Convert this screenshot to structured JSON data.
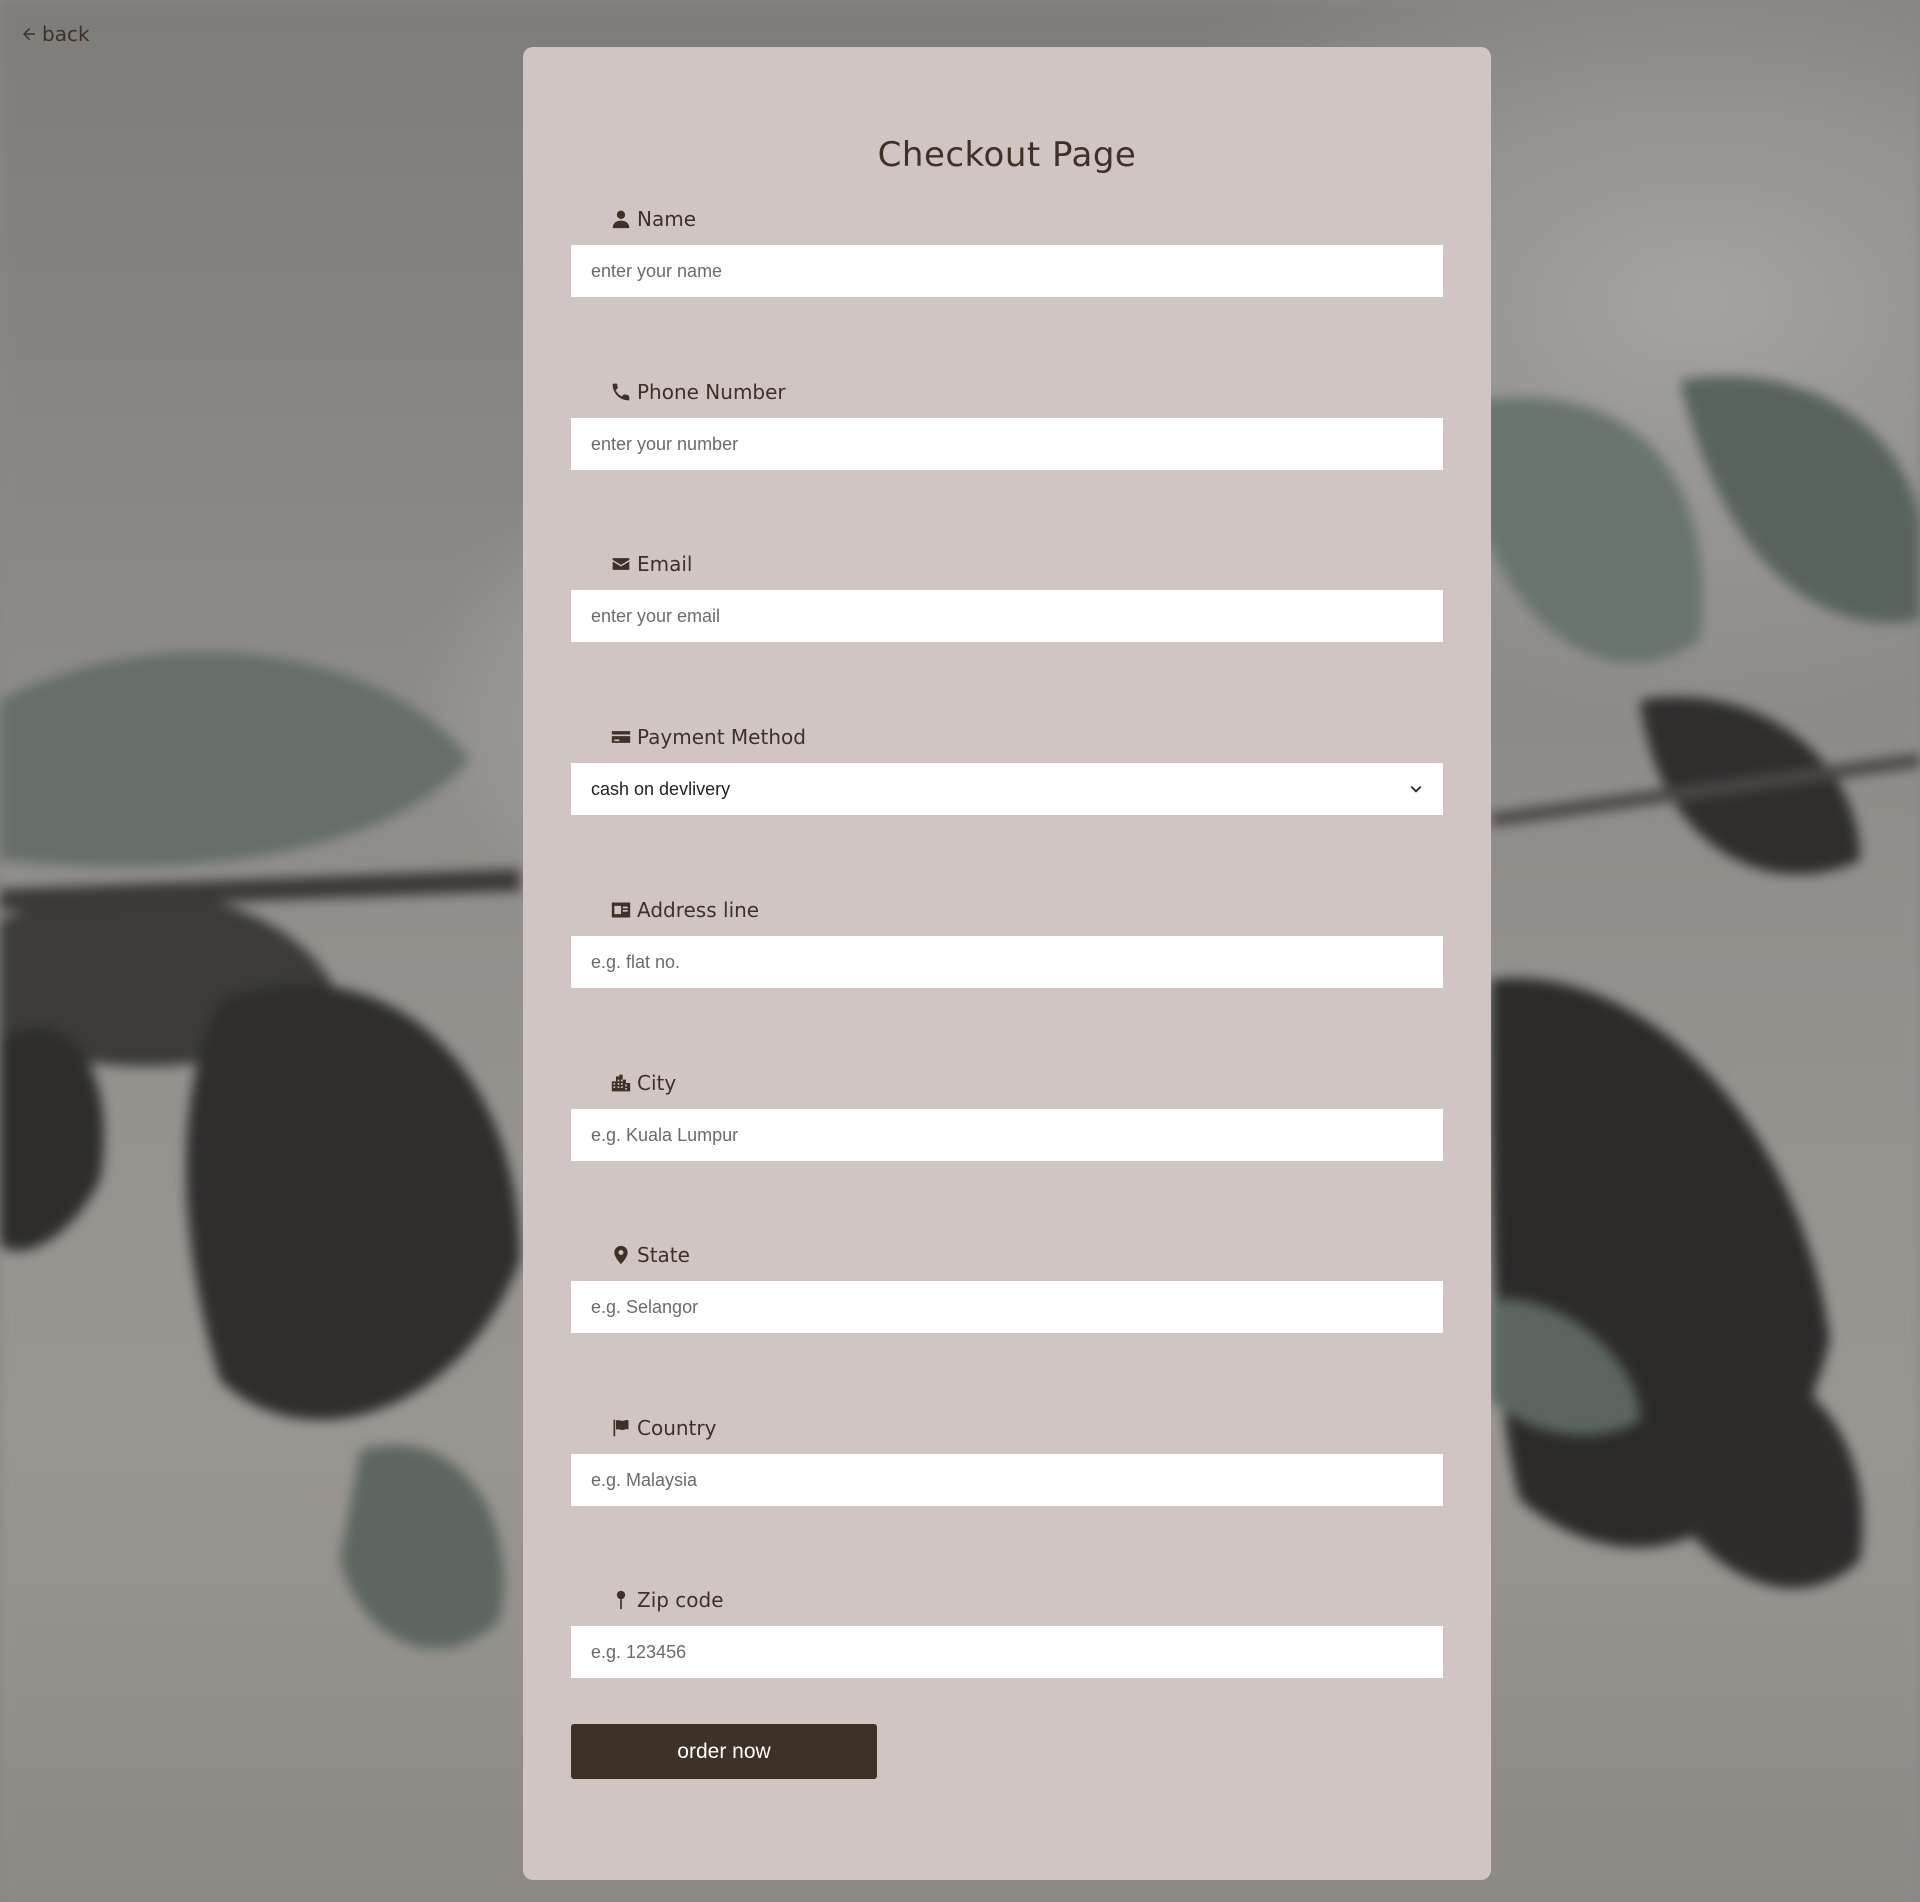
{
  "page": {
    "back_label": "back",
    "title": "Checkout Page"
  },
  "form": {
    "fields": [
      {
        "label": "Name",
        "icon": "user-icon",
        "placeholder": "enter your name"
      },
      {
        "label": "Phone Number",
        "icon": "phone-icon",
        "placeholder": "enter your number"
      },
      {
        "label": "Email",
        "icon": "envelope-icon",
        "placeholder": "enter your email"
      },
      {
        "label": "Payment Method",
        "icon": "credit-card-icon",
        "selected": "cash on devlivery"
      },
      {
        "label": "Address line",
        "icon": "address-card-icon",
        "placeholder": "e.g. flat no."
      },
      {
        "label": "City",
        "icon": "city-icon",
        "placeholder": "e.g. Kuala Lumpur"
      },
      {
        "label": "State",
        "icon": "map-marker-icon",
        "placeholder": "e.g. Selangor"
      },
      {
        "label": "Country",
        "icon": "flag-icon",
        "placeholder": "e.g. Malaysia"
      },
      {
        "label": "Zip code",
        "icon": "map-pin-icon",
        "placeholder": "e.g. 123456"
      }
    ],
    "submit_label": "order now"
  },
  "colors": {
    "card_background": "#d0c5c2",
    "text": "#3e3127",
    "button_background": "#3e3127",
    "button_text": "#ffffff",
    "input_background": "#ffffff"
  }
}
